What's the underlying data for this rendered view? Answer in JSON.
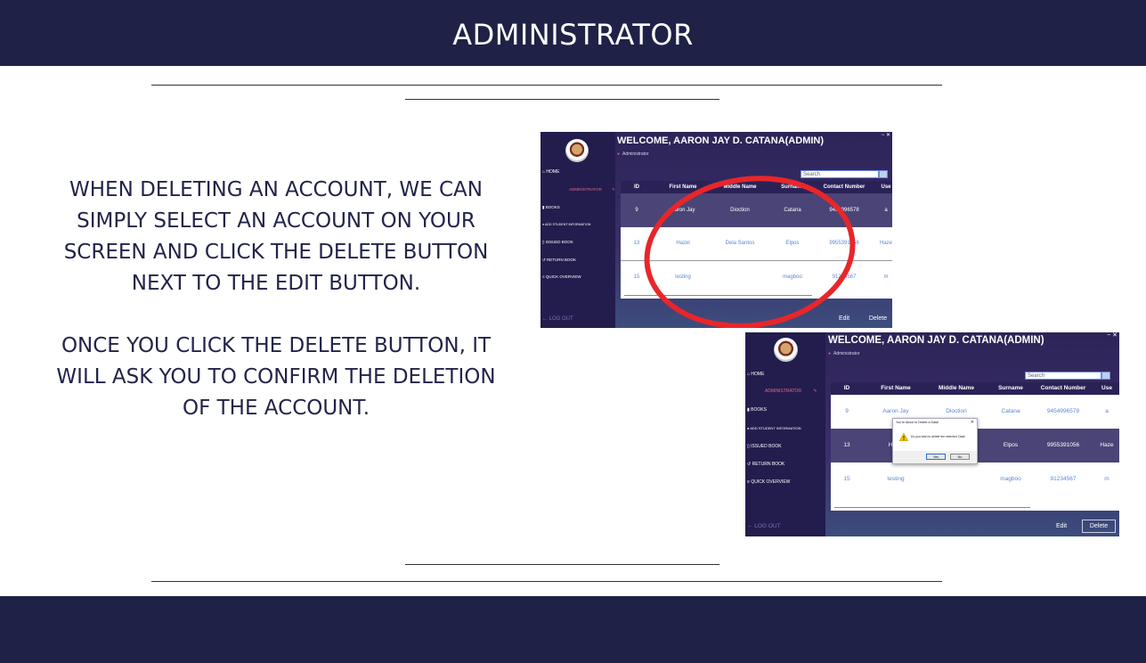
{
  "header": {
    "title": "ADMINISTRATOR"
  },
  "instructions": {
    "paragraph1": [
      "WHEN DELETING AN ACCOUNT, WE CAN",
      "SIMPLY SELECT AN ACCOUNT ON YOUR",
      "SCREEN AND CLICK THE DELETE BUTTON",
      "NEXT TO THE EDIT BUTTON."
    ],
    "paragraph2": [
      "ONCE YOU CLICK THE DELETE BUTTON, IT",
      "WILL ASK YOU TO CONFIRM THE DELETION",
      "OF THE ACCOUNT."
    ]
  },
  "app": {
    "welcome": "WELCOME, AARON JAY D. CATANA(ADMIN)",
    "role": "Administrator",
    "window_controls": "− ✕",
    "nav": {
      "home": "HOME",
      "administrator": "ADMINISTRATOR",
      "books": "BOOKS",
      "add_student": "ADD STUDENT INFORMATION",
      "issued": "ISSUED BOOK",
      "return": "RETURN BOOK",
      "overview": "QUICK OVERVIEW",
      "logout": "← LOG OUT"
    },
    "search_placeholder": "Search",
    "columns": [
      "ID",
      "First Name",
      "Middle Name",
      "Surname",
      "Contact Number",
      "Use"
    ],
    "rows": [
      [
        "9",
        "Aaron Jay",
        "Dioction",
        "Catana",
        "9454996578",
        "a"
      ],
      [
        "13",
        "Hazel",
        "Dela Santos",
        "Elpos",
        "9955391056",
        "Haze"
      ],
      [
        "15",
        "testing",
        "",
        "magboo",
        "91234567",
        "m"
      ]
    ],
    "edit_label": "Edit",
    "delete_label": "Delete",
    "selected_row_before": 0,
    "selected_row_after": 1
  },
  "dialog": {
    "title": "You're About to Delete a Data!",
    "message": "Do you wish to delete the selected 'Data'",
    "yes": "Yes",
    "no": "No",
    "close": "✕"
  },
  "colors": {
    "navy": "#1f2147",
    "highlight": "#e8262a",
    "link_blue": "#5b86d6"
  }
}
